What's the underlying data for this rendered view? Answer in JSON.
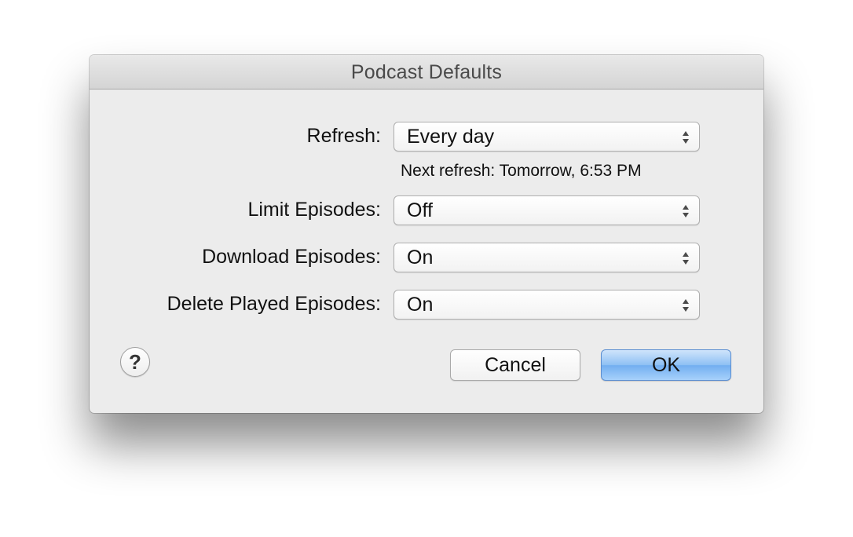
{
  "window": {
    "title": "Podcast Defaults"
  },
  "settings": {
    "refresh": {
      "label": "Refresh:",
      "value": "Every day"
    },
    "next_refresh": "Next refresh: Tomorrow, 6:53 PM",
    "limit_episodes": {
      "label": "Limit Episodes:",
      "value": "Off"
    },
    "download_episodes": {
      "label": "Download Episodes:",
      "value": "On"
    },
    "delete_played_episodes": {
      "label": "Delete Played Episodes:",
      "value": "On"
    }
  },
  "buttons": {
    "help": "?",
    "cancel": "Cancel",
    "ok": "OK"
  },
  "colors": {
    "accent_button": "#8ec0f4",
    "window_background": "#ececec"
  },
  "icons": {
    "popup_arrows": "up-down-arrows-icon",
    "help": "help-icon"
  }
}
